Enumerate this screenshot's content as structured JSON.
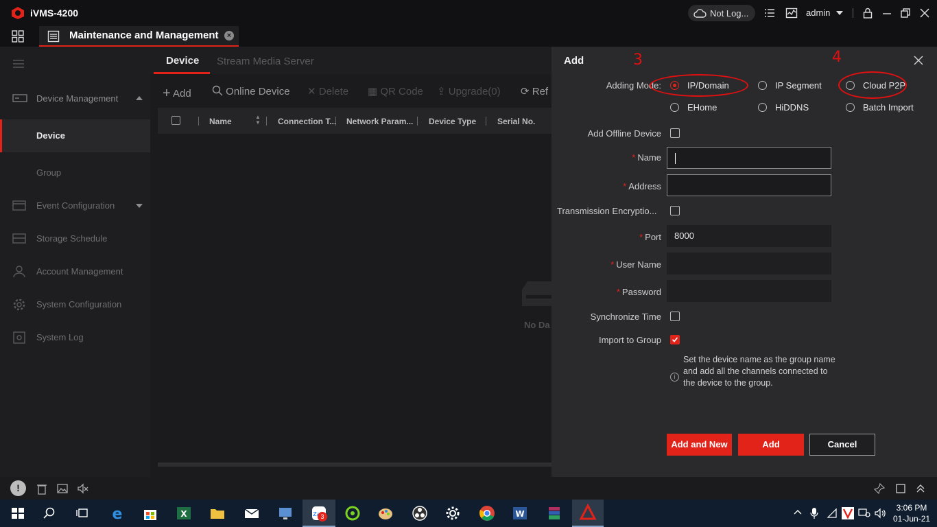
{
  "app": {
    "title": "iVMS-4200",
    "login_status": "Not Log...",
    "user": "admin",
    "tab_title": "Maintenance and Management",
    "tab_close_glyph": "×"
  },
  "sidebar": {
    "items": [
      {
        "label": "Device Management",
        "icon": "device-management-icon"
      },
      {
        "label": "Device"
      },
      {
        "label": "Group"
      },
      {
        "label": "Event Configuration",
        "icon": "event-icon"
      },
      {
        "label": "Storage Schedule",
        "icon": "storage-icon"
      },
      {
        "label": "Account Management",
        "icon": "account-icon"
      },
      {
        "label": "System Configuration",
        "icon": "gear-icon"
      },
      {
        "label": "System Log",
        "icon": "log-icon"
      }
    ]
  },
  "main": {
    "tabs": [
      "Device",
      "Stream Media Server"
    ],
    "toolbar": {
      "add": "Add",
      "online_device": "Online Device",
      "delete": "Delete",
      "qr_code": "QR Code",
      "upgrade": "Upgrade(0)",
      "refresh": "Ref"
    },
    "columns": [
      "Name",
      "Connection T...",
      "Network Param...",
      "Device Type",
      "Serial No."
    ],
    "empty_text": "No Da"
  },
  "add_panel": {
    "title": "Add",
    "adding_mode_label": "Adding Mode:",
    "modes": [
      "IP/Domain",
      "IP Segment",
      "Cloud P2P",
      "EHome",
      "HiDDNS",
      "Batch Import"
    ],
    "selected_mode": "IP/Domain",
    "add_offline_label": "Add Offline Device",
    "name_label": "Name",
    "name_value": "",
    "address_label": "Address",
    "address_value": "",
    "transmission_label": "Transmission Encryptio...",
    "port_label": "Port",
    "port_value": "8000",
    "username_label": "User Name",
    "username_value": "",
    "password_label": "Password",
    "password_value": "",
    "sync_time_label": "Synchronize Time",
    "import_group_label": "Import to Group",
    "hint": "Set the device name as the group name and add all the channels connected to the device to the group.",
    "buttons": {
      "add_and_new": "Add and New",
      "add": "Add",
      "cancel": "Cancel"
    },
    "required_marker": "*"
  },
  "annotations": {
    "mark_3": "3",
    "mark_4": "4"
  },
  "taskbar": {
    "time": "3:06 PM",
    "date": "01-Jun-21",
    "badge": "3"
  },
  "colors": {
    "accent": "#e2231a",
    "annotation": "#e01010"
  }
}
